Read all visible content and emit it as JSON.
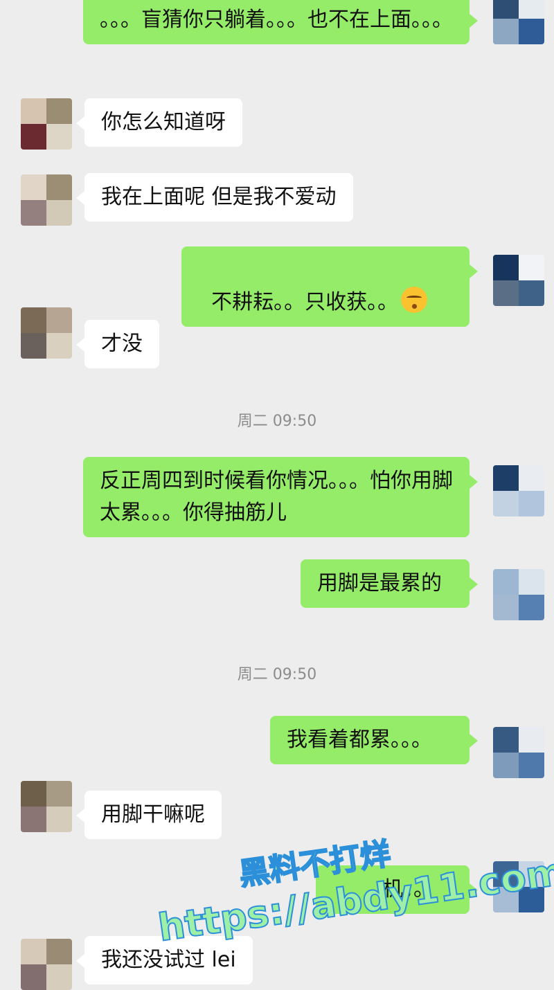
{
  "messages": [
    {
      "side": "right",
      "text": "。。。盲猜你只躺着。。。也不在上面。。。",
      "colors": [
        "#2f4e73",
        "#e6ebef",
        "#8da6c2",
        "#2f5c96"
      ]
    },
    {
      "side": "left",
      "text": "你怎么知道呀",
      "colors": [
        "#d6c4b0",
        "#9b8c74",
        "#6a2a2f",
        "#ddd6c6"
      ]
    },
    {
      "side": "left",
      "text": "我在上面呢 但是我不爱动",
      "colors": [
        "#e1d5c8",
        "#9b8e75",
        "#958080",
        "#d2cab7"
      ]
    },
    {
      "side": "right",
      "text": "不耕耘。。只收获。。",
      "emoji": "😔",
      "colors": [
        "#17345d",
        "#f1f3f6",
        "#5a6f86",
        "#3f6289"
      ]
    },
    {
      "side": "left",
      "text": "才没",
      "colors": [
        "#7a6a56",
        "#b6a593",
        "#6a605c",
        "#d9d0c0"
      ]
    },
    {
      "side": "right",
      "text": "反正周四到时候看你情况。。。怕你用脚太累。。。你得抽筋儿",
      "colors": [
        "#1d3e66",
        "#e9edf1",
        "#c3d2e2",
        "#b1c6dd"
      ]
    },
    {
      "side": "right",
      "text": "用脚是最累的",
      "colors": [
        "#9db6d1",
        "#dbe4ec",
        "#a3b9d1",
        "#5780b2"
      ]
    },
    {
      "side": "right",
      "text": "我看着都累。。。",
      "colors": [
        "#375a82",
        "#e8ecf0",
        "#7e9bbc",
        "#4f78ab"
      ]
    },
    {
      "side": "left",
      "text": "用脚干嘛呢",
      "colors": [
        "#6e5f4b",
        "#a89b86",
        "#8a7474",
        "#d5ccbb"
      ]
    },
    {
      "side": "right",
      "text": "机。。。",
      "colors": [
        "#3d6694",
        "#c6d4e3",
        "#a7bcd5",
        "#2c5d98"
      ]
    },
    {
      "side": "left",
      "text": "我还没试过 lei",
      "colors": [
        "#d7c9b8",
        "#9a8c74",
        "#826e6e",
        "#d6cdbc"
      ]
    }
  ],
  "timestamps": [
    "周二 09:50",
    "周二 09:50"
  ],
  "watermark": {
    "line1": "黑料不打烊",
    "line2": "https://abdy11.com"
  }
}
